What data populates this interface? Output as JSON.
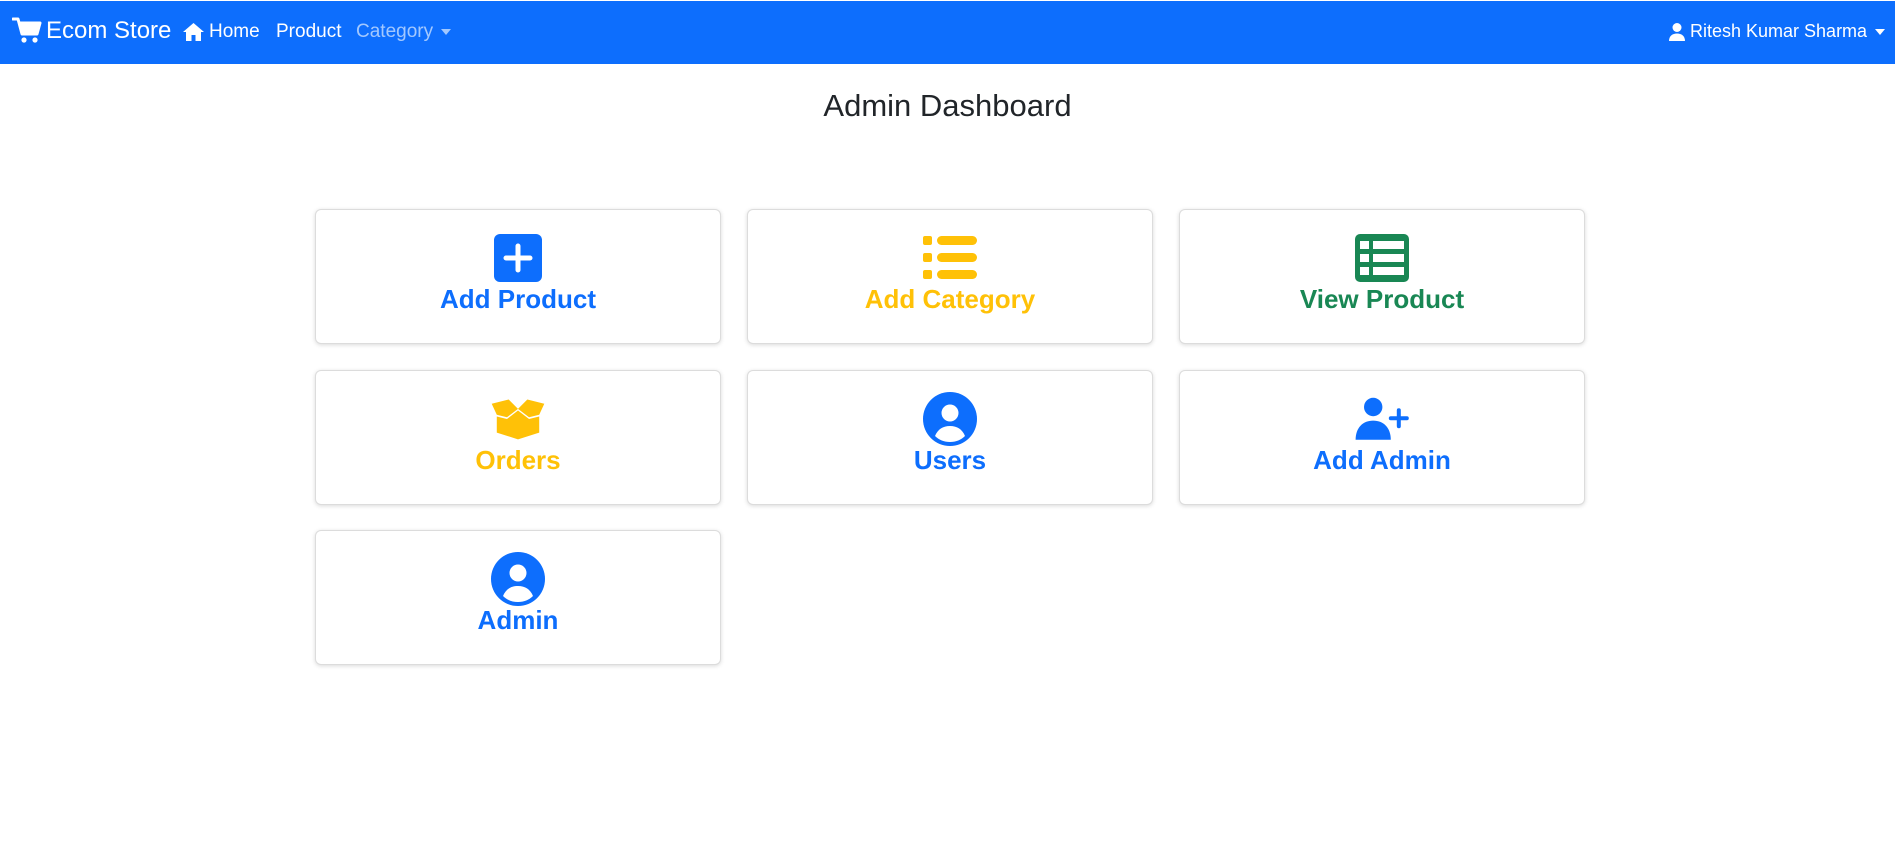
{
  "navbar": {
    "brand": "Ecom Store",
    "brand_icon": "cart-icon",
    "home": "Home",
    "home_icon": "home-icon",
    "product": "Product",
    "category": "Category",
    "user": "Ritesh Kumar Sharma",
    "user_icon": "user-icon",
    "background_color": "#0d6efd"
  },
  "page": {
    "title": "Admin Dashboard"
  },
  "cards": [
    {
      "label": "Add Product",
      "icon": "plus-square-icon",
      "color": "#0d6efd"
    },
    {
      "label": "Add Category",
      "icon": "list-icon",
      "color": "#ffc107"
    },
    {
      "label": "View Product",
      "icon": "table-icon",
      "color": "#198754"
    },
    {
      "label": "Orders",
      "icon": "box-open-icon",
      "color": "#ffc107"
    },
    {
      "label": "Users",
      "icon": "user-circle-icon",
      "color": "#0d6efd"
    },
    {
      "label": "Add Admin",
      "icon": "user-plus-icon",
      "color": "#0d6efd"
    },
    {
      "label": "Admin",
      "icon": "user-circle-icon",
      "color": "#0d6efd"
    }
  ]
}
